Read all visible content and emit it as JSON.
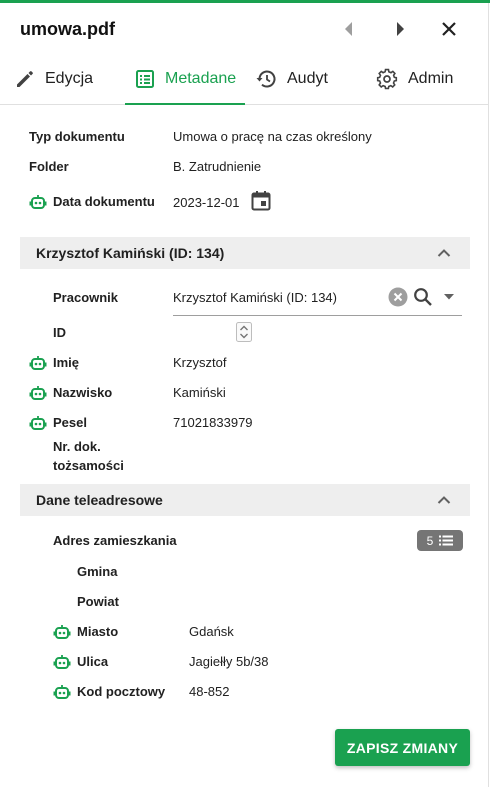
{
  "header": {
    "title": "umowa.pdf"
  },
  "tabs": [
    {
      "label": "Edycja",
      "icon": "pencil-icon"
    },
    {
      "label": "Metadane",
      "icon": "list-icon",
      "active": true
    },
    {
      "label": "Audyt",
      "icon": "history-icon"
    },
    {
      "label": "Admin",
      "icon": "gear-icon"
    }
  ],
  "accent_color": "#1aa150",
  "document": {
    "type_label": "Typ dokumentu",
    "type_value": "Umowa o pracę na czas określony",
    "folder_label": "Folder",
    "folder_value": "B. Zatrudnienie",
    "date_label": "Data dokumentu",
    "date_value": "2023-12-01"
  },
  "employee_section": {
    "title": "Krzysztof Kamiński (ID: 134)",
    "employee_label": "Pracownik",
    "employee_value": "Krzysztof Kamiński (ID: 134)",
    "id_label": "ID",
    "id_value": "",
    "first_name_label": "Imię",
    "first_name_value": "Krzysztof",
    "last_name_label": "Nazwisko",
    "last_name_value": "Kamiński",
    "pesel_label": "Pesel",
    "pesel_value": "71021833979",
    "doc_no_label_1": "Nr. dok.",
    "doc_no_label_2": "tożsamości",
    "doc_no_value": ""
  },
  "address_section": {
    "title": "Dane teleadresowe",
    "address_label": "Adres zamieszkania",
    "address_count": "5",
    "gmina_label": "Gmina",
    "gmina_value": "",
    "powiat_label": "Powiat",
    "powiat_value": "",
    "city_label": "Miasto",
    "city_value": "Gdańsk",
    "street_label": "Ulica",
    "street_value": "Jagiełły 5b/38",
    "postal_label": "Kod pocztowy",
    "postal_value": "48-852"
  },
  "actions": {
    "save_label": "ZAPISZ ZMIANY"
  }
}
